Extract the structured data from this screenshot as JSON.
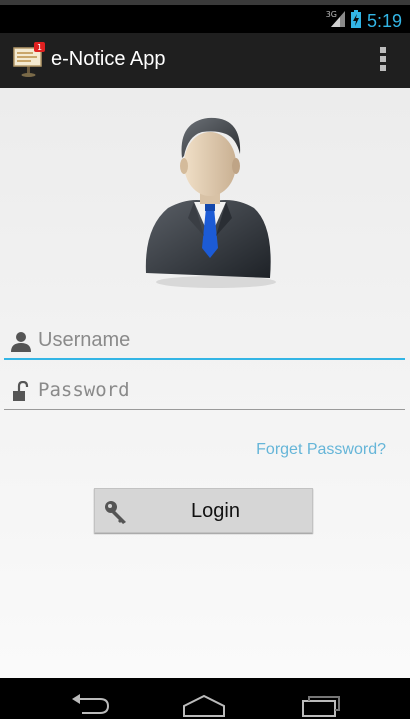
{
  "status_bar": {
    "network_type": "3G",
    "time": "5:19",
    "clock_color": "#33b5e5"
  },
  "action_bar": {
    "title": "e-Notice App",
    "notification_count": "1",
    "icons": [
      "notice-board-icon",
      "overflow-menu-icon"
    ]
  },
  "login_form": {
    "username_placeholder": "Username",
    "password_placeholder": "Password",
    "forget_password_label": "Forget Password?",
    "login_label": "Login",
    "accent_color": "#33b5e5",
    "link_color": "#65b5d8",
    "icons": [
      "user-avatar",
      "person-icon",
      "unlock-icon",
      "key-icon"
    ]
  },
  "nav_bar": {
    "icons": [
      "back-icon",
      "home-icon",
      "recent-apps-icon"
    ]
  }
}
